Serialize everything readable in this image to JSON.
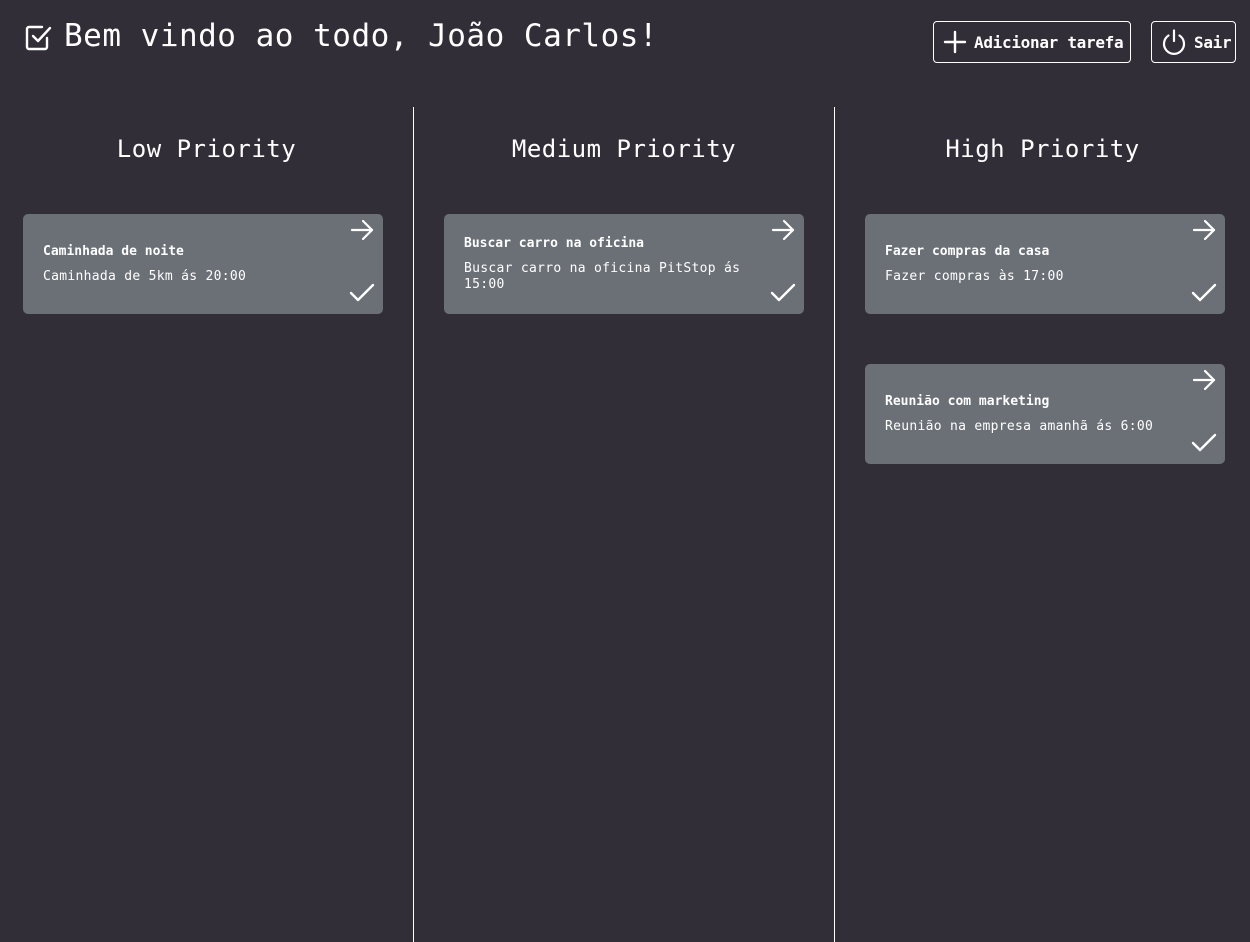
{
  "header": {
    "welcome": "Bem vindo ao todo, João Carlos!",
    "add_task_label": "Adicionar tarefa",
    "exit_label": "Sair"
  },
  "columns": [
    {
      "title": "Low Priority",
      "tasks": [
        {
          "title": "Caminhada de noite",
          "description": "Caminhada de 5km ás 20:00"
        }
      ]
    },
    {
      "title": "Medium Priority",
      "tasks": [
        {
          "title": "Buscar carro na oficina",
          "description": "Buscar carro na oficina PitStop ás 15:00"
        }
      ]
    },
    {
      "title": "High Priority",
      "tasks": [
        {
          "title": "Fazer compras da casa",
          "description": "Fazer compras às 17:00"
        },
        {
          "title": "Reunião com marketing",
          "description": "Reunião na empresa amanhã ás 6:00"
        }
      ]
    }
  ],
  "colors": {
    "background": "#312e38",
    "card": "#6b7077",
    "foreground": "#ffffff"
  },
  "icons": {
    "logo": "check-square-icon",
    "add": "plus-icon",
    "exit": "power-icon",
    "move": "arrow-right-icon",
    "complete": "check-icon"
  }
}
